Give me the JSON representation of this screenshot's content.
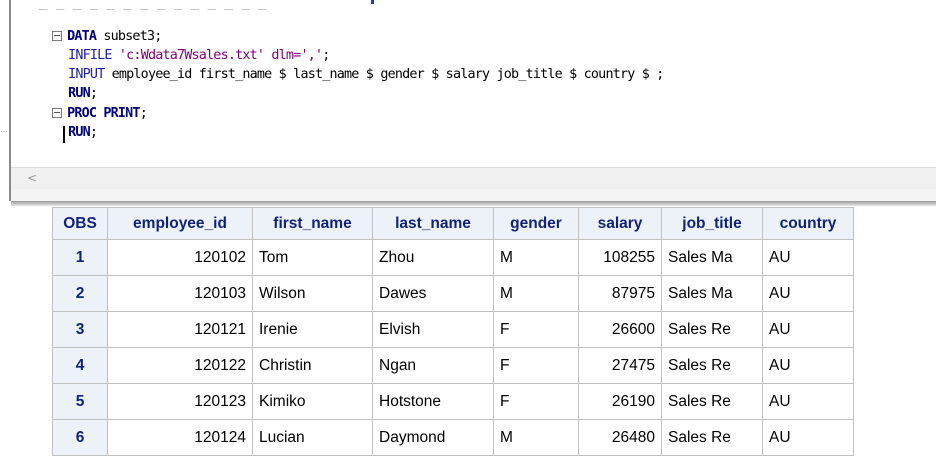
{
  "editor": {
    "code": {
      "line1_kw": "DATA",
      "line1_rest": " subset3;",
      "line2_kw": "INFILE",
      "line2_str": " 'c:Wdata7Wsales.txt' dlm=','",
      "line2_end": ";",
      "line3_kw": "INPUT",
      "line3_rest": " employee_id first_name $ last_name $ gender $ salary job_title $ country $ ;",
      "line4_kw": "RUN",
      "line4_end": ";",
      "line5_kw": "PROC PRINT",
      "line5_end": ";",
      "line6_kw": "RUN",
      "line6_end": ";"
    },
    "scroll_left_glyph": "<"
  },
  "table": {
    "headers": {
      "obs": "OBS",
      "employee_id": "employee_id",
      "first_name": "first_name",
      "last_name": "last_name",
      "gender": "gender",
      "salary": "salary",
      "job_title": "job_title",
      "country": "country"
    },
    "rows": [
      {
        "obs": "1",
        "employee_id": "120102",
        "first_name": "Tom",
        "last_name": "Zhou",
        "gender": "M",
        "salary": "108255",
        "job_title": "Sales Ma",
        "country": "AU"
      },
      {
        "obs": "2",
        "employee_id": "120103",
        "first_name": "Wilson",
        "last_name": "Dawes",
        "gender": "M",
        "salary": "87975",
        "job_title": "Sales Ma",
        "country": "AU"
      },
      {
        "obs": "3",
        "employee_id": "120121",
        "first_name": "Irenie",
        "last_name": "Elvish",
        "gender": "F",
        "salary": "26600",
        "job_title": "Sales Re",
        "country": "AU"
      },
      {
        "obs": "4",
        "employee_id": "120122",
        "first_name": "Christin",
        "last_name": "Ngan",
        "gender": "F",
        "salary": "27475",
        "job_title": "Sales Re",
        "country": "AU"
      },
      {
        "obs": "5",
        "employee_id": "120123",
        "first_name": "Kimiko",
        "last_name": "Hotstone",
        "gender": "F",
        "salary": "26190",
        "job_title": "Sales Re",
        "country": "AU"
      },
      {
        "obs": "6",
        "employee_id": "120124",
        "first_name": "Lucian",
        "last_name": "Daymond",
        "gender": "M",
        "salary": "26480",
        "job_title": "Sales Re",
        "country": "AU"
      }
    ]
  },
  "colors": {
    "keyword": "#000080",
    "macro_keyword": "#800080",
    "string": "#800080",
    "table_header_bg": "#edf2f9",
    "table_header_text": "#112277",
    "grid": "#c1c1c1"
  }
}
